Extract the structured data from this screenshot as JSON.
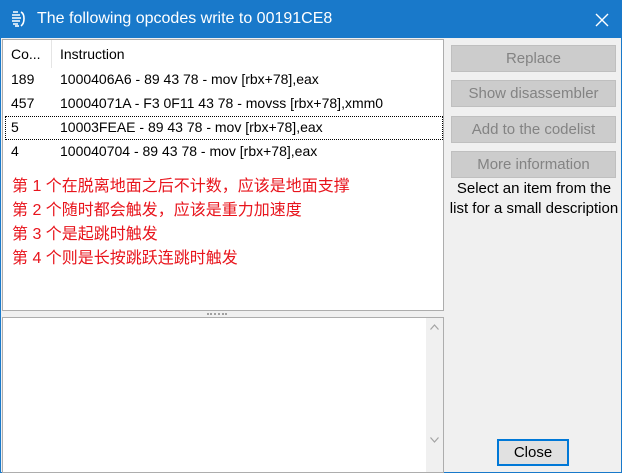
{
  "window": {
    "title": "The following opcodes write to 00191CE8"
  },
  "list": {
    "columns": [
      "Co...",
      "Instruction"
    ],
    "rows": [
      {
        "count": "189",
        "instruction": "1000406A6 - 89 43 78  - mov [rbx+78],eax"
      },
      {
        "count": "457",
        "instruction": "10004071A - F3 0F11 43 78  - movss [rbx+78],xmm0"
      },
      {
        "count": "5",
        "instruction": "10003FEAE - 89 43 78  - mov [rbx+78],eax"
      },
      {
        "count": "4",
        "instruction": "100040704 - 89 43 78  - mov [rbx+78],eax"
      }
    ],
    "focused_row": 2,
    "notes": [
      "第 1 个在脱离地面之后不计数，应该是地面支撑",
      "第 2 个随时都会触发，应该是重力加速度",
      "第 3 个是起跳时触发",
      "第 4 个则是长按跳跃连跳时触发"
    ],
    "notes_color": "#e8141c"
  },
  "buttons": {
    "replace": "Replace",
    "show_disassembler": "Show disassembler",
    "add_to_codelist": "Add to the codelist",
    "more_information": "More information",
    "close": "Close"
  },
  "description": "Select an item from the list for a small description",
  "colors": {
    "titlebar": "#1979ca",
    "button_focus": "#0078d7"
  },
  "icons": {
    "app": "cheat-engine-icon",
    "close": "close-icon"
  }
}
